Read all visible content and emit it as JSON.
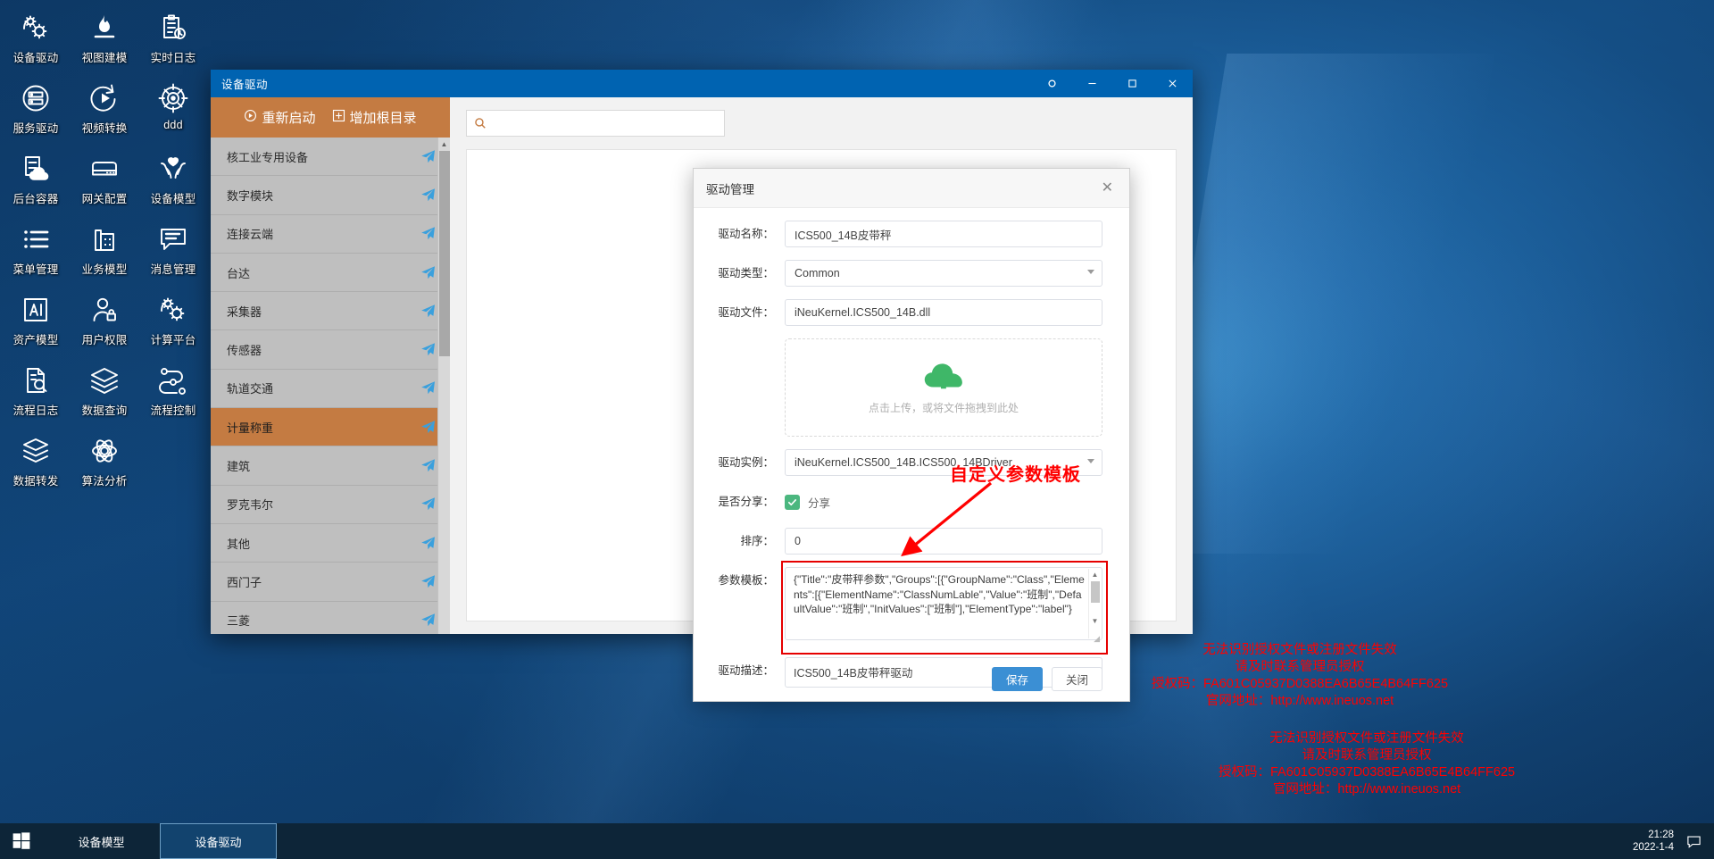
{
  "desktop": {
    "icons": [
      {
        "label": "设备驱动",
        "icon": "gears-icon"
      },
      {
        "label": "视图建模",
        "icon": "flame-icon"
      },
      {
        "label": "实时日志",
        "icon": "clipboard-clock-icon"
      },
      {
        "label": "服务驱动",
        "icon": "server-circle-icon"
      },
      {
        "label": "视频转换",
        "icon": "play-refresh-icon"
      },
      {
        "label": "ddd",
        "icon": "target-icon"
      },
      {
        "label": "后台容器",
        "icon": "server-cloud-icon"
      },
      {
        "label": "网关配置",
        "icon": "router-icon"
      },
      {
        "label": "设备模型",
        "icon": "hands-heart-icon"
      },
      {
        "label": "菜单管理",
        "icon": "list-icon"
      },
      {
        "label": "业务模型",
        "icon": "building-icon"
      },
      {
        "label": "消息管理",
        "icon": "chat-icon"
      },
      {
        "label": "资产模型",
        "icon": "ai-square-icon"
      },
      {
        "label": "用户权限",
        "icon": "user-lock-icon"
      },
      {
        "label": "计算平台",
        "icon": "gears-icon"
      },
      {
        "label": "流程日志",
        "icon": "doc-search-icon"
      },
      {
        "label": "数据查询",
        "icon": "layers-icon"
      },
      {
        "label": "流程控制",
        "icon": "flow-nodes-icon"
      },
      {
        "label": "数据转发",
        "icon": "stack-arrow-icon"
      },
      {
        "label": "算法分析",
        "icon": "network-atom-icon"
      }
    ],
    "license_notice_1": {
      "line1": "无法识别授权文件或注册文件失效",
      "line2": "请及时联系管理员授权",
      "line3": "授权码：FA601C05937D0388EA6B65E4B64FF625",
      "line4": "官网地址：http://www.ineuos.net"
    },
    "license_notice_2": {
      "line1": "无法识别授权文件或注册文件失效",
      "line2": "请及时联系管理员授权",
      "line3": "授权码：FA601C05937D0388EA6B65E4B64FF625",
      "line4": "官网地址：http://www.ineuos.net"
    }
  },
  "window": {
    "title": "设备驱动",
    "controls": {
      "refresh": "refresh-icon",
      "minimize": "minimize-icon",
      "maximize": "maximize-icon",
      "close": "close-icon"
    },
    "toolbar": {
      "restart": "重新启动",
      "add_root": "增加根目录"
    },
    "categories": [
      {
        "label": "核工业专用设备",
        "active": false
      },
      {
        "label": "数字模块",
        "active": false
      },
      {
        "label": "连接云端",
        "active": false
      },
      {
        "label": "台达",
        "active": false
      },
      {
        "label": "采集器",
        "active": false
      },
      {
        "label": "传感器",
        "active": false
      },
      {
        "label": "轨道交通",
        "active": false
      },
      {
        "label": "计量称重",
        "active": true
      },
      {
        "label": "建筑",
        "active": false
      },
      {
        "label": "罗克韦尔",
        "active": false
      },
      {
        "label": "其他",
        "active": false
      },
      {
        "label": "西门子",
        "active": false
      },
      {
        "label": "三菱",
        "active": false
      }
    ]
  },
  "modal": {
    "title": "驱动管理",
    "close_icon": "close-icon",
    "fields": {
      "driver_name_label": "驱动名称：",
      "driver_name_value": "ICS500_14B皮带秤",
      "driver_type_label": "驱动类型：",
      "driver_type_value": "Common",
      "driver_file_label": "驱动文件：",
      "driver_file_value": "iNeuKernel.ICS500_14B.dll",
      "upload_hint": "点击上传，或将文件拖拽到此处",
      "driver_instance_label": "驱动实例：",
      "driver_instance_value": "iNeuKernel.ICS500_14B.ICS500_14BDriver",
      "share_label": "是否分享：",
      "share_checkbox_text": "分享",
      "share_checked": true,
      "sort_label": "排序：",
      "sort_value": "0",
      "param_template_label": "参数模板：",
      "param_template_value": "{\"Title\":\"皮带秤参数\",\"Groups\":[{\"GroupName\":\"Class\",\"Elements\":[{\"ElementName\":\"ClassNumLable\",\"Value\":\"班制\",\"DefaultValue\":\"班制\",\"InitValues\":[\"班制\"],\"ElementType\":\"label\"}",
      "driver_desc_label": "驱动描述：",
      "driver_desc_value": "ICS500_14B皮带秤驱动"
    },
    "buttons": {
      "save": "保存",
      "close": "关闭"
    }
  },
  "annotation": {
    "text": "自定义参数模板",
    "color": "#ff0000"
  },
  "taskbar": {
    "start_icon": "windows-logo-icon",
    "items": [
      {
        "label": "设备模型",
        "active": false
      },
      {
        "label": "设备驱动",
        "active": true
      }
    ],
    "clock_time": "21:28",
    "clock_date": "2022-1-4",
    "notification_icon": "speech-bubble-icon"
  },
  "colors": {
    "accent_blue": "#0063b1",
    "toolbar_orange": "#c47b42",
    "alert_red": "#ff0000",
    "primary_button": "#3b8fd4"
  }
}
